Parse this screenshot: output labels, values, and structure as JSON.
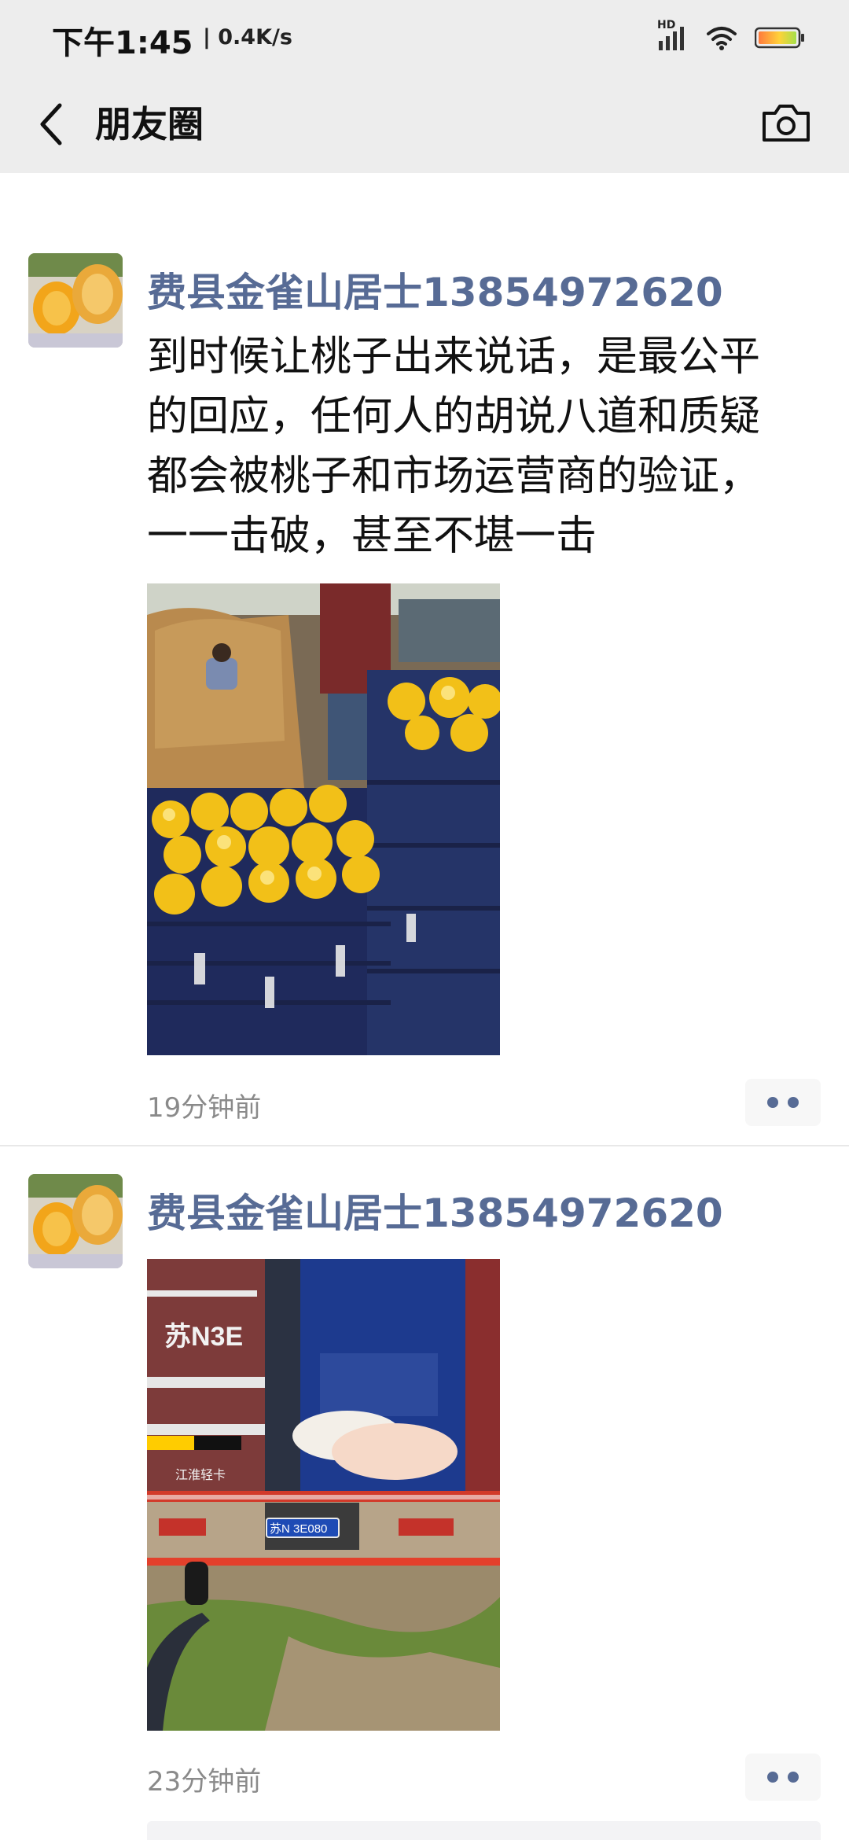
{
  "status_bar": {
    "time": "下午1:45",
    "network_speed": "| 0.4K/s",
    "hd_label": "HD",
    "icons": [
      "hd-signal-icon",
      "wifi-icon",
      "battery-icon"
    ]
  },
  "nav": {
    "back_icon": "chevron-left-icon",
    "title": "朋友圈",
    "camera_icon": "camera-icon"
  },
  "posts": [
    {
      "author": "费县金雀山居士13854972620",
      "text": "到时候让桃子出来说话，是最公平的回应，任何人的胡说八道和质疑都会被桃子和市场运营商的验证，一一击破，甚至不堪一击",
      "time": "19分钟前",
      "photo": "peaches-in-crates-photo"
    },
    {
      "author": "费县金雀山居士13854972620",
      "text": "",
      "time": "23分钟前",
      "photo": "truck-rear-photo",
      "plate_large": "苏N3E",
      "plate_small": "苏N 3E080",
      "truck_brand": "江淮轻卡"
    }
  ],
  "colors": {
    "nickname": "#576b95",
    "header_bg": "#ededed",
    "time_text": "#8a8a8a"
  }
}
